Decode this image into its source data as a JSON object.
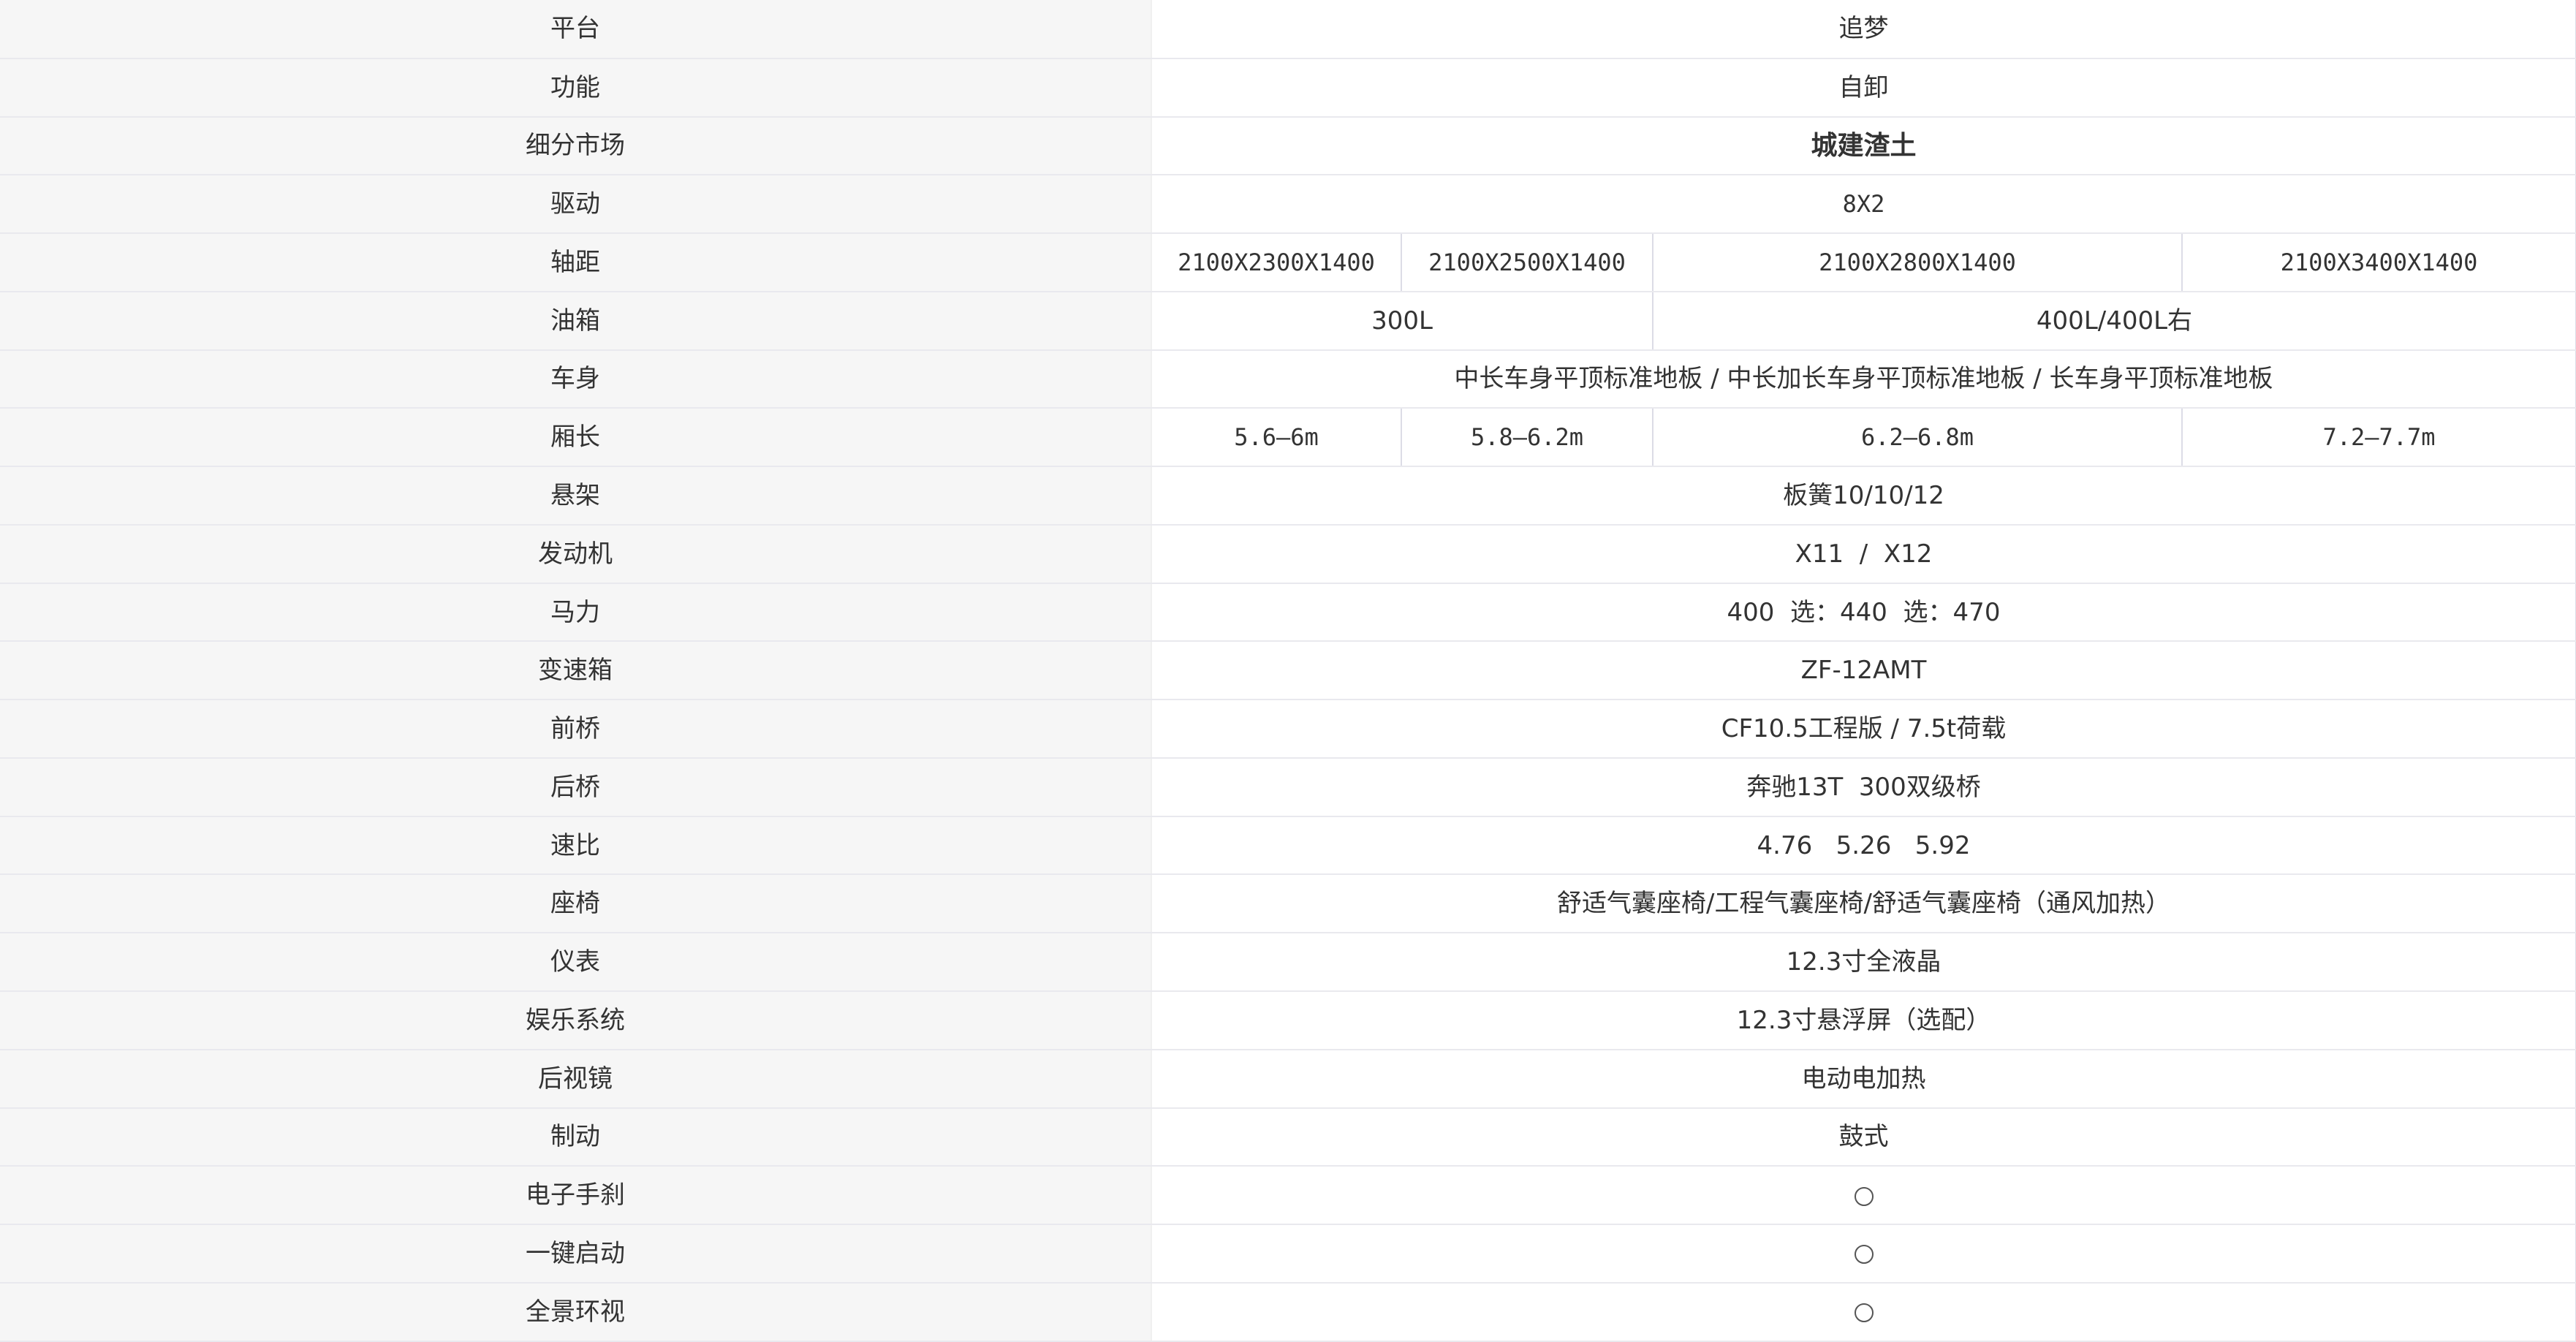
{
  "rows": {
    "platform": {
      "label": "平台",
      "value": "追梦"
    },
    "function": {
      "label": "功能",
      "value": "自卸"
    },
    "segment": {
      "label": "细分市场",
      "value": "城建渣土"
    },
    "drive": {
      "label": "驱动",
      "value": "8X2"
    },
    "wheelbase": {
      "label": "轴距",
      "values": [
        "2100X2300X1400",
        "2100X2500X1400",
        "2100X2800X1400",
        "2100X3400X1400"
      ]
    },
    "fuel_tank": {
      "label": "油箱",
      "values": [
        "300L",
        "400L/400L右"
      ]
    },
    "body": {
      "label": "车身",
      "value": "中长车身平顶标准地板 / 中长加长车身平顶标准地板 / 长车身平顶标准地板"
    },
    "box_length": {
      "label": "厢长",
      "values": [
        "5.6—6m",
        "5.8—6.2m",
        "6.2—6.8m",
        "7.2—7.7m"
      ]
    },
    "suspension": {
      "label": "悬架",
      "value": "板簧10/10/12"
    },
    "engine": {
      "label": "发动机",
      "value": "X11  /  X12"
    },
    "horsepower": {
      "label": "马力",
      "value": "400  选：440  选：470"
    },
    "gearbox": {
      "label": "变速箱",
      "value": "ZF-12AMT"
    },
    "front_axle": {
      "label": "前桥",
      "value": "CF10.5工程版 / 7.5t荷载"
    },
    "rear_axle": {
      "label": "后桥",
      "value": "奔驰13T  300双级桥"
    },
    "ratio": {
      "label": "速比",
      "value": "4.76   5.26   5.92"
    },
    "seat": {
      "label": "座椅",
      "value": "舒适气囊座椅/工程气囊座椅/舒适气囊座椅（通风加热）"
    },
    "instrument": {
      "label": "仪表",
      "value": "12.3寸全液晶"
    },
    "infotainment": {
      "label": "娱乐系统",
      "value": "12.3寸悬浮屏（选配）"
    },
    "mirror": {
      "label": "后视镜",
      "value": "电动电加热"
    },
    "brake": {
      "label": "制动",
      "value": "鼓式"
    },
    "epb": {
      "label": "电子手刹",
      "value": "circle-icon"
    },
    "keyless_start": {
      "label": "一键启动",
      "value": "circle-icon"
    },
    "panoramic_view": {
      "label": "全景环视",
      "value": "circle-icon"
    }
  }
}
